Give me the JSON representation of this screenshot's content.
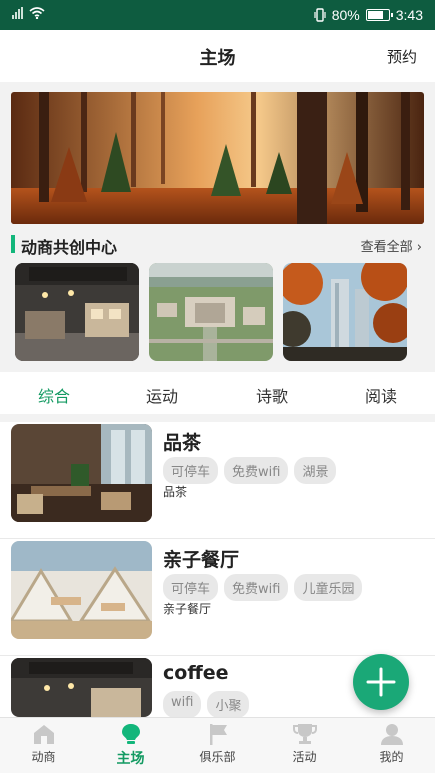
{
  "status_bar": {
    "battery": "80%",
    "time": "3:43",
    "icons": [
      "signal-icon",
      "wifi-icon",
      "vibrate-icon",
      "battery-icon"
    ]
  },
  "header": {
    "title": "主场",
    "action": "预约"
  },
  "section": {
    "title": "动商共创中心",
    "more": "查看全部"
  },
  "banner": {
    "alt_icon": "forest-banner-image"
  },
  "thumbs": [
    "coffee-shop-image",
    "campus-aerial-image",
    "tower-autumn-image"
  ],
  "tabs": [
    {
      "label": "综合",
      "active": true
    },
    {
      "label": "运动",
      "active": false
    },
    {
      "label": "诗歌",
      "active": false
    },
    {
      "label": "阅读",
      "active": false
    }
  ],
  "venues": [
    {
      "name": "品茶",
      "tags": [
        "可停车",
        "免费wifi",
        "湖景"
      ],
      "desc": "品茶"
    },
    {
      "name": "亲子餐厅",
      "tags": [
        "可停车",
        "免费wifi",
        "儿童乐园"
      ],
      "desc": "亲子餐厅"
    },
    {
      "name": "coffee",
      "tags": [
        "wifi",
        "小聚"
      ],
      "desc": ""
    }
  ],
  "fab": {
    "icon": "plus-icon"
  },
  "bottom_nav": [
    {
      "label": "动商",
      "icon": "home-icon",
      "active": false
    },
    {
      "label": "主场",
      "icon": "bulb-icon",
      "active": true
    },
    {
      "label": "俱乐部",
      "icon": "flag-icon",
      "active": false
    },
    {
      "label": "活动",
      "icon": "trophy-icon",
      "active": false
    },
    {
      "label": "我的",
      "icon": "user-icon",
      "active": false
    }
  ],
  "colors": {
    "status_bar": "#0e5c40",
    "accent": "#13b67b",
    "active_text": "#139a62",
    "fab": "#1aa877"
  }
}
